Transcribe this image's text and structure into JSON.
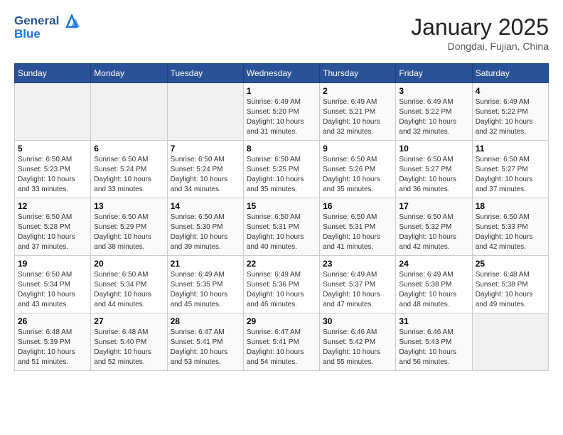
{
  "header": {
    "logo_line1": "General",
    "logo_line2": "Blue",
    "month_title": "January 2025",
    "location": "Dongdai, Fujian, China"
  },
  "weekdays": [
    "Sunday",
    "Monday",
    "Tuesday",
    "Wednesday",
    "Thursday",
    "Friday",
    "Saturday"
  ],
  "weeks": [
    [
      {
        "day": "",
        "sunrise": "",
        "sunset": "",
        "daylight": ""
      },
      {
        "day": "",
        "sunrise": "",
        "sunset": "",
        "daylight": ""
      },
      {
        "day": "",
        "sunrise": "",
        "sunset": "",
        "daylight": ""
      },
      {
        "day": "1",
        "sunrise": "Sunrise: 6:49 AM",
        "sunset": "Sunset: 5:20 PM",
        "daylight": "Daylight: 10 hours and 31 minutes."
      },
      {
        "day": "2",
        "sunrise": "Sunrise: 6:49 AM",
        "sunset": "Sunset: 5:21 PM",
        "daylight": "Daylight: 10 hours and 32 minutes."
      },
      {
        "day": "3",
        "sunrise": "Sunrise: 6:49 AM",
        "sunset": "Sunset: 5:22 PM",
        "daylight": "Daylight: 10 hours and 32 minutes."
      },
      {
        "day": "4",
        "sunrise": "Sunrise: 6:49 AM",
        "sunset": "Sunset: 5:22 PM",
        "daylight": "Daylight: 10 hours and 32 minutes."
      }
    ],
    [
      {
        "day": "5",
        "sunrise": "Sunrise: 6:50 AM",
        "sunset": "Sunset: 5:23 PM",
        "daylight": "Daylight: 10 hours and 33 minutes."
      },
      {
        "day": "6",
        "sunrise": "Sunrise: 6:50 AM",
        "sunset": "Sunset: 5:24 PM",
        "daylight": "Daylight: 10 hours and 33 minutes."
      },
      {
        "day": "7",
        "sunrise": "Sunrise: 6:50 AM",
        "sunset": "Sunset: 5:24 PM",
        "daylight": "Daylight: 10 hours and 34 minutes."
      },
      {
        "day": "8",
        "sunrise": "Sunrise: 6:50 AM",
        "sunset": "Sunset: 5:25 PM",
        "daylight": "Daylight: 10 hours and 35 minutes."
      },
      {
        "day": "9",
        "sunrise": "Sunrise: 6:50 AM",
        "sunset": "Sunset: 5:26 PM",
        "daylight": "Daylight: 10 hours and 35 minutes."
      },
      {
        "day": "10",
        "sunrise": "Sunrise: 6:50 AM",
        "sunset": "Sunset: 5:27 PM",
        "daylight": "Daylight: 10 hours and 36 minutes."
      },
      {
        "day": "11",
        "sunrise": "Sunrise: 6:50 AM",
        "sunset": "Sunset: 5:27 PM",
        "daylight": "Daylight: 10 hours and 37 minutes."
      }
    ],
    [
      {
        "day": "12",
        "sunrise": "Sunrise: 6:50 AM",
        "sunset": "Sunset: 5:28 PM",
        "daylight": "Daylight: 10 hours and 37 minutes."
      },
      {
        "day": "13",
        "sunrise": "Sunrise: 6:50 AM",
        "sunset": "Sunset: 5:29 PM",
        "daylight": "Daylight: 10 hours and 38 minutes."
      },
      {
        "day": "14",
        "sunrise": "Sunrise: 6:50 AM",
        "sunset": "Sunset: 5:30 PM",
        "daylight": "Daylight: 10 hours and 39 minutes."
      },
      {
        "day": "15",
        "sunrise": "Sunrise: 6:50 AM",
        "sunset": "Sunset: 5:31 PM",
        "daylight": "Daylight: 10 hours and 40 minutes."
      },
      {
        "day": "16",
        "sunrise": "Sunrise: 6:50 AM",
        "sunset": "Sunset: 5:31 PM",
        "daylight": "Daylight: 10 hours and 41 minutes."
      },
      {
        "day": "17",
        "sunrise": "Sunrise: 6:50 AM",
        "sunset": "Sunset: 5:32 PM",
        "daylight": "Daylight: 10 hours and 42 minutes."
      },
      {
        "day": "18",
        "sunrise": "Sunrise: 6:50 AM",
        "sunset": "Sunset: 5:33 PM",
        "daylight": "Daylight: 10 hours and 42 minutes."
      }
    ],
    [
      {
        "day": "19",
        "sunrise": "Sunrise: 6:50 AM",
        "sunset": "Sunset: 5:34 PM",
        "daylight": "Daylight: 10 hours and 43 minutes."
      },
      {
        "day": "20",
        "sunrise": "Sunrise: 6:50 AM",
        "sunset": "Sunset: 5:34 PM",
        "daylight": "Daylight: 10 hours and 44 minutes."
      },
      {
        "day": "21",
        "sunrise": "Sunrise: 6:49 AM",
        "sunset": "Sunset: 5:35 PM",
        "daylight": "Daylight: 10 hours and 45 minutes."
      },
      {
        "day": "22",
        "sunrise": "Sunrise: 6:49 AM",
        "sunset": "Sunset: 5:36 PM",
        "daylight": "Daylight: 10 hours and 46 minutes."
      },
      {
        "day": "23",
        "sunrise": "Sunrise: 6:49 AM",
        "sunset": "Sunset: 5:37 PM",
        "daylight": "Daylight: 10 hours and 47 minutes."
      },
      {
        "day": "24",
        "sunrise": "Sunrise: 6:49 AM",
        "sunset": "Sunset: 5:38 PM",
        "daylight": "Daylight: 10 hours and 48 minutes."
      },
      {
        "day": "25",
        "sunrise": "Sunrise: 6:48 AM",
        "sunset": "Sunset: 5:38 PM",
        "daylight": "Daylight: 10 hours and 49 minutes."
      }
    ],
    [
      {
        "day": "26",
        "sunrise": "Sunrise: 6:48 AM",
        "sunset": "Sunset: 5:39 PM",
        "daylight": "Daylight: 10 hours and 51 minutes."
      },
      {
        "day": "27",
        "sunrise": "Sunrise: 6:48 AM",
        "sunset": "Sunset: 5:40 PM",
        "daylight": "Daylight: 10 hours and 52 minutes."
      },
      {
        "day": "28",
        "sunrise": "Sunrise: 6:47 AM",
        "sunset": "Sunset: 5:41 PM",
        "daylight": "Daylight: 10 hours and 53 minutes."
      },
      {
        "day": "29",
        "sunrise": "Sunrise: 6:47 AM",
        "sunset": "Sunset: 5:41 PM",
        "daylight": "Daylight: 10 hours and 54 minutes."
      },
      {
        "day": "30",
        "sunrise": "Sunrise: 6:46 AM",
        "sunset": "Sunset: 5:42 PM",
        "daylight": "Daylight: 10 hours and 55 minutes."
      },
      {
        "day": "31",
        "sunrise": "Sunrise: 6:46 AM",
        "sunset": "Sunset: 5:43 PM",
        "daylight": "Daylight: 10 hours and 56 minutes."
      },
      {
        "day": "",
        "sunrise": "",
        "sunset": "",
        "daylight": ""
      }
    ]
  ]
}
